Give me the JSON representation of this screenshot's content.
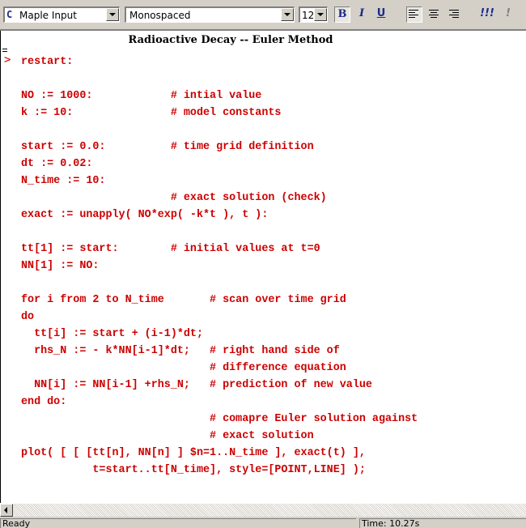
{
  "toolbar": {
    "style_icon": "C",
    "style_value": "Maple Input",
    "font_value": "Monospaced",
    "size_value": "12",
    "bold_label": "B",
    "italic_label": "I",
    "underline_label": "U",
    "exec_all_label": "!!!",
    "exec_label": "!"
  },
  "document": {
    "caption": "Radioactive Decay  --  Euler Method",
    "prompt": ">",
    "code_lines": [
      "restart:",
      "",
      "NO := 1000:            # intial value",
      "k := 10:               # model constants",
      "",
      "start := 0.0:          # time grid definition",
      "dt := 0.02:",
      "N_time := 10:",
      "                       # exact solution (check)",
      "exact := unapply( NO*exp( -k*t ), t ):",
      "",
      "tt[1] := start:        # initial values at t=0",
      "NN[1] := NO:",
      "",
      "for i from 2 to N_time       # scan over time grid",
      "do",
      "  tt[i] := start + (i-1)*dt;",
      "  rhs_N := - k*NN[i-1]*dt;   # right hand side of",
      "                             # difference equation",
      "  NN[i] := NN[i-1] +rhs_N;   # prediction of new value",
      "end do:",
      "                             # comapre Euler solution against",
      "                             # exact solution",
      "plot( [ [ [tt[n], NN[n] ] $n=1..N_time ], exact(t) ],",
      "           t=start..tt[N_time], style=[POINT,LINE] );"
    ]
  },
  "status": {
    "left": "Ready",
    "right": "Time: 10.27s"
  },
  "colors": {
    "code": "#cc0000",
    "icon_blue": "#1c2a8c"
  }
}
